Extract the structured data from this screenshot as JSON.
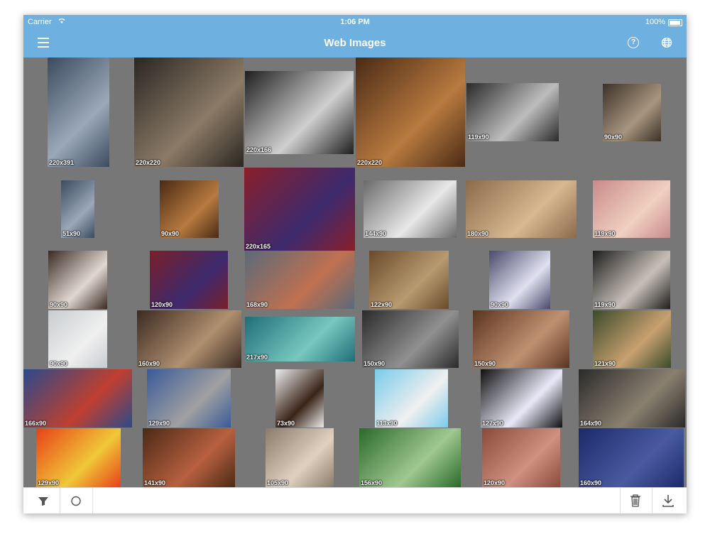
{
  "status_bar": {
    "carrier": "Carrier",
    "time": "1:06 PM",
    "battery": "100%"
  },
  "nav_bar": {
    "title": "Web Images"
  },
  "images": [
    {
      "size": "220x391",
      "colors": [
        "#3b4a5e",
        "#9aa8b8"
      ]
    },
    {
      "size": "220x220",
      "colors": [
        "#2a2622",
        "#8b7a66"
      ]
    },
    {
      "size": "220x166",
      "colors": [
        "#1e1e1e",
        "#cfcfcf"
      ]
    },
    {
      "size": "220x220",
      "colors": [
        "#4a2a14",
        "#b77a40"
      ]
    },
    {
      "size": "119x90",
      "colors": [
        "#2a2a2a",
        "#bdbdbd"
      ]
    },
    {
      "size": "90x90",
      "colors": [
        "#3a3128",
        "#a8957e"
      ]
    },
    {
      "size": "51x90",
      "colors": [
        "#3b4a5e",
        "#9aa8b8"
      ]
    },
    {
      "size": "90x90",
      "colors": [
        "#4a2a14",
        "#b77a40"
      ]
    },
    {
      "size": "220x165",
      "colors": [
        "#8a1f2a",
        "#3d2a6e"
      ]
    },
    {
      "size": "144x90",
      "colors": [
        "#6a6a6a",
        "#e8e8e8"
      ]
    },
    {
      "size": "180x90",
      "colors": [
        "#8a6a4a",
        "#d8b890"
      ]
    },
    {
      "size": "119x90",
      "colors": [
        "#c98a8a",
        "#f0d0c0"
      ]
    },
    {
      "size": "90x90",
      "colors": [
        "#3a2a24",
        "#e0d8d0"
      ]
    },
    {
      "size": "120x90",
      "colors": [
        "#7a1f2a",
        "#3d2a6e"
      ]
    },
    {
      "size": "168x90",
      "colors": [
        "#5a6a7a",
        "#c07050"
      ]
    },
    {
      "size": "122x90",
      "colors": [
        "#6a4a2a",
        "#b89a70"
      ]
    },
    {
      "size": "90x90",
      "colors": [
        "#4a4a6a",
        "#e0e0f0"
      ]
    },
    {
      "size": "119x90",
      "colors": [
        "#1e1e1e",
        "#c8c0b8"
      ]
    },
    {
      "size": "90x90",
      "colors": [
        "#c8ccd0",
        "#f0f0f0"
      ]
    },
    {
      "size": "160x90",
      "colors": [
        "#3a2a20",
        "#b09070"
      ]
    },
    {
      "size": "217x90",
      "colors": [
        "#1e6e78",
        "#78c8c0"
      ]
    },
    {
      "size": "150x90",
      "colors": [
        "#2a2a2a",
        "#909090"
      ]
    },
    {
      "size": "150x90",
      "colors": [
        "#5a3420",
        "#c09070"
      ]
    },
    {
      "size": "121x90",
      "colors": [
        "#3a4a2a",
        "#c8a070"
      ]
    },
    {
      "size": "166x90",
      "colors": [
        "#2a4a8a",
        "#c04030"
      ]
    },
    {
      "size": "129x90",
      "colors": [
        "#3a5a9a",
        "#a0a0a0"
      ]
    },
    {
      "size": "73x90",
      "colors": [
        "#ececec",
        "#3a2418"
      ]
    },
    {
      "size": "113x90",
      "colors": [
        "#7acaea",
        "#f0f0f0"
      ]
    },
    {
      "size": "127x90",
      "colors": [
        "#101010",
        "#e8e8f8"
      ]
    },
    {
      "size": "164x90",
      "colors": [
        "#2a2a2a",
        "#8a8070"
      ]
    },
    {
      "size": "129x90",
      "colors": [
        "#e84018",
        "#f0c838"
      ]
    },
    {
      "size": "141x90",
      "colors": [
        "#4a2a14",
        "#b86040"
      ]
    },
    {
      "size": "105x90",
      "colors": [
        "#8a7a6a",
        "#e0d0c0"
      ]
    },
    {
      "size": "156x90",
      "colors": [
        "#2a6a2a",
        "#a0c890"
      ]
    },
    {
      "size": "120x90",
      "colors": [
        "#8a4a3a",
        "#d09080"
      ]
    },
    {
      "size": "160x90",
      "colors": [
        "#1a2a6a",
        "#4a5aa0"
      ]
    }
  ],
  "toolbar": {
    "left_icons": [
      "filter-icon",
      "circle-icon"
    ],
    "right_icons": [
      "trash-icon",
      "download-icon"
    ]
  }
}
